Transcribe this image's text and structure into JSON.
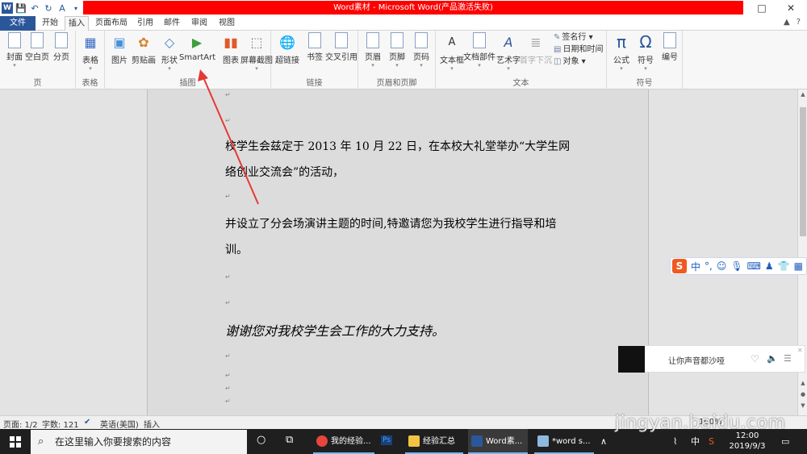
{
  "window": {
    "title": "Word素材 - Microsoft Word(产品激活失败)",
    "controls": [
      "□",
      "✕"
    ]
  },
  "tabs": {
    "file": "文件",
    "items": [
      "开始",
      "插入",
      "页面布局",
      "引用",
      "邮件",
      "审阅",
      "视图"
    ],
    "active": "插入"
  },
  "ribbon": {
    "groups": {
      "pages": "页",
      "tables": "表格",
      "illustrations": "插图",
      "links": "链接",
      "header_footer": "页眉和页脚",
      "text": "文本",
      "symbols": "符号"
    },
    "buttons": {
      "cover": "封面",
      "blank": "空白页",
      "page_break": "分页",
      "table": "表格",
      "picture": "图片",
      "clipart": "剪贴画",
      "shapes": "形状",
      "smartart": "SmartArt",
      "chart": "图表",
      "screenshot": "屏幕截图",
      "hyperlink": "超链接",
      "bookmark": "书签",
      "crossref": "交叉引用",
      "header": "页眉",
      "footer": "页脚",
      "pagenum": "页码",
      "textbox": "文本框",
      "quickparts": "文档部件",
      "wordart": "艺术字",
      "dropcap": "首字下沉",
      "signature": "签名行",
      "datetime": "日期和时间",
      "object": "对象",
      "equation": "公式",
      "symbol": "符号",
      "number": "编号"
    }
  },
  "document": {
    "para1_line1": "校学生会兹定于 2013 年 10 月 22 日，在本校大礼堂举办“大学生网",
    "para1_line2": "络创业交流会”的活动，",
    "para2_line1": "并设立了分会场演讲主题的时间,特邀请您为我校学生进行指导和培",
    "para2_line2": "训。",
    "para3": "谢谢您对我校学生会工作的大力支持。",
    "return_mark": "↵"
  },
  "ime": {
    "chinese": "中",
    "punct": "°,"
  },
  "music_popup": {
    "song": "让你声音都沙哑"
  },
  "statusbar": {
    "page": "页面: 1/2",
    "words": "字数: 121",
    "language": "英语(美国)",
    "mode": "插入",
    "zoom": "100%"
  },
  "taskbar": {
    "search_placeholder": "在这里输入你要搜索的内容",
    "tasks": [
      "我的经验...",
      "经验汇总",
      "Word素...",
      "*word s..."
    ],
    "ime_indicator": "中",
    "time": "12:00",
    "date": "2019/9/3"
  },
  "watermark": "jingyan.baidu.com",
  "colors": {
    "word_blue": "#2b579a",
    "title_red": "#ff0000",
    "annotation_arrow": "#e53935"
  }
}
